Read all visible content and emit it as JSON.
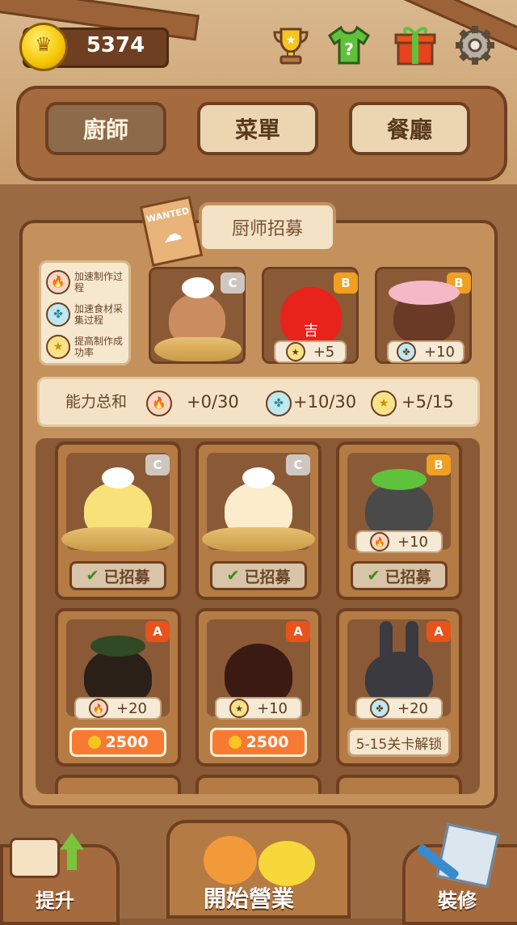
{
  "header": {
    "coins": "5374",
    "icons": [
      "trophy-icon",
      "shirt-question-icon",
      "gift-icon",
      "settings-gear-icon"
    ]
  },
  "tabs": [
    {
      "label": "廚師",
      "active": true
    },
    {
      "label": "菜單",
      "active": false
    },
    {
      "label": "餐廳",
      "active": false
    }
  ],
  "recruit": {
    "title": "厨师招募",
    "wanted_text": "WANTED"
  },
  "legend": [
    {
      "icon": "fire-icon",
      "text": "加速制作过程"
    },
    {
      "icon": "fan-icon",
      "text": "加速食材采集过程"
    },
    {
      "icon": "star-icon",
      "text": "提高制作成功率"
    }
  ],
  "slots": [
    {
      "grade": "C",
      "bonus": ""
    },
    {
      "grade": "B",
      "bonus_icon": "star-icon",
      "bonus": "+5",
      "badge_text": "吉"
    },
    {
      "grade": "B",
      "bonus_icon": "fan-icon",
      "bonus": "+10"
    }
  ],
  "ability": {
    "label": "能力总和",
    "fire": "+0/30",
    "fan": "+10/30",
    "star": "+5/15"
  },
  "chefs": [
    {
      "grade": "C",
      "bonus_icon": "",
      "bonus": "",
      "button": "已招募",
      "button_type": "recruited",
      "check": "✔"
    },
    {
      "grade": "C",
      "bonus_icon": "",
      "bonus": "",
      "button": "已招募",
      "button_type": "recruited",
      "check": "✔"
    },
    {
      "grade": "B",
      "bonus_icon": "fire-icon",
      "bonus": "+10",
      "button": "已招募",
      "button_type": "recruited",
      "check": "✔"
    },
    {
      "grade": "A",
      "bonus_icon": "fire-icon",
      "bonus": "+20",
      "button": "2500",
      "button_type": "price"
    },
    {
      "grade": "A",
      "bonus_icon": "star-icon",
      "bonus": "+10",
      "button": "2500",
      "button_type": "price"
    },
    {
      "grade": "A",
      "bonus_icon": "fan-icon",
      "bonus": "+20",
      "button": "5-15关卡解锁",
      "button_type": "locked"
    }
  ],
  "bottom": {
    "upgrade": "提升",
    "start": "開始營業",
    "decorate": "裝修"
  }
}
